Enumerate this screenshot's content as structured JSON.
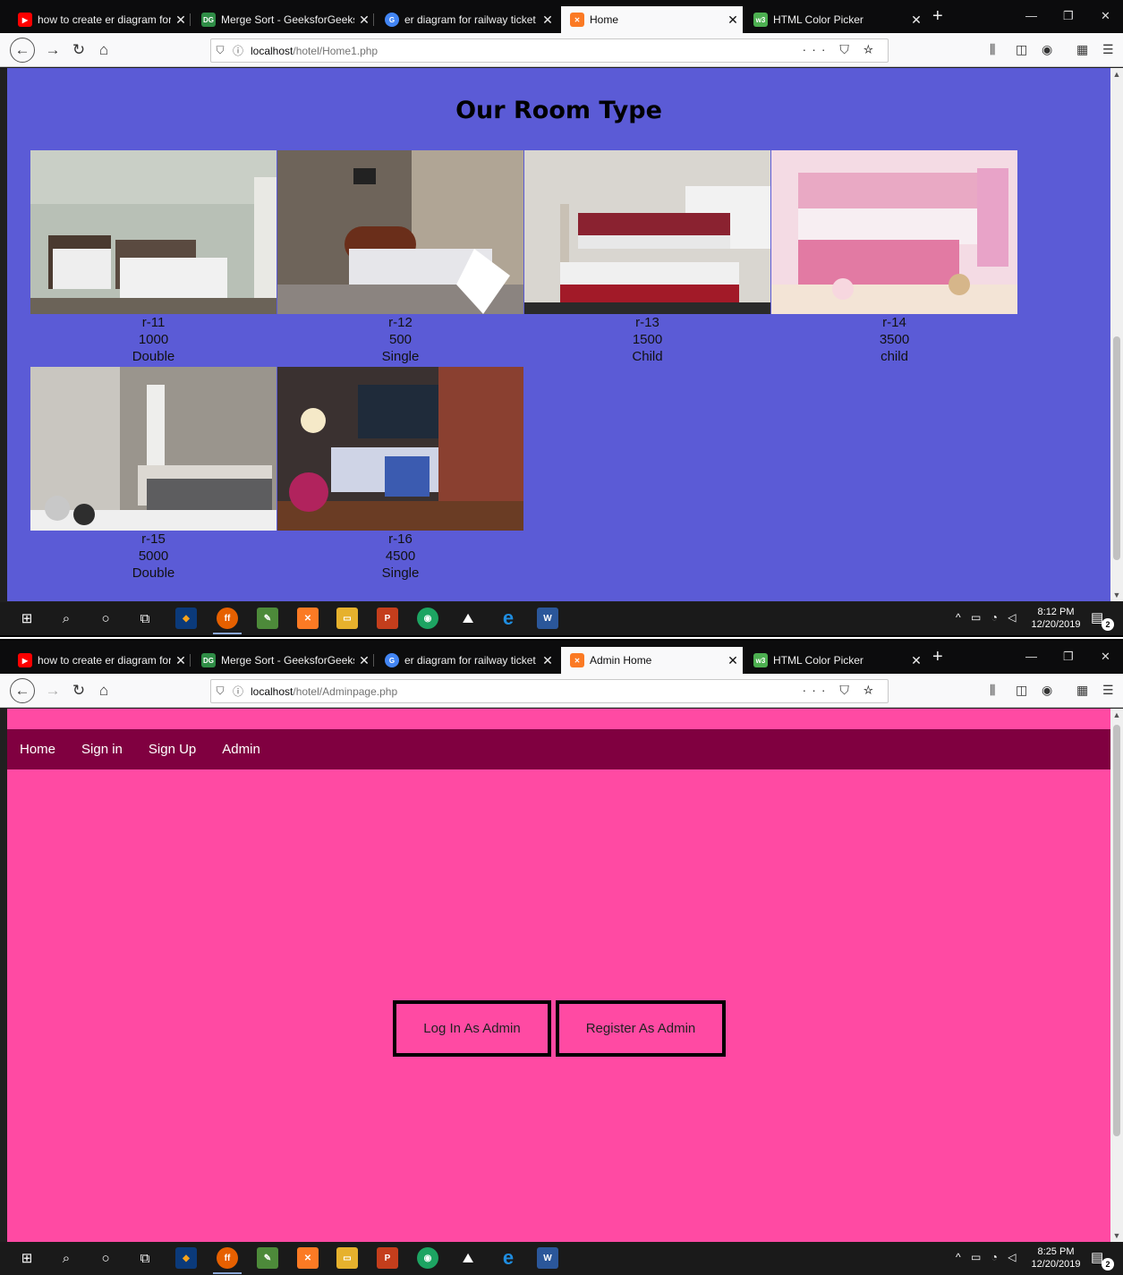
{
  "shot1": {
    "tabs": [
      {
        "title": "how to create er diagram for tr",
        "fav": "youtube-icon",
        "color": "#ff0000",
        "glyph": "▶"
      },
      {
        "title": "Merge Sort - GeeksforGeeks",
        "fav": "geeksforgeeks-icon",
        "color": "#2f8d46",
        "glyph": "DG"
      },
      {
        "title": "er diagram for railway ticket bo",
        "fav": "google-icon",
        "color": "#4285f4",
        "glyph": "G"
      },
      {
        "title": "Home",
        "fav": "xampp-icon",
        "color": "#fb7a24",
        "glyph": "✕"
      },
      {
        "title": "HTML Color Picker",
        "fav": "w3schools-icon",
        "color": "#4caf50",
        "glyph": "w3"
      }
    ],
    "url_host": "localhost",
    "url_path": "/hotel/Home1.php",
    "heading": "Our Room Type",
    "rooms": [
      {
        "id": "r-11",
        "price": "1000",
        "type": "Double"
      },
      {
        "id": "r-12",
        "price": "500",
        "type": "Single"
      },
      {
        "id": "r-13",
        "price": "1500",
        "type": "Child"
      },
      {
        "id": "r-14",
        "price": "3500",
        "type": "child"
      },
      {
        "id": "r-15",
        "price": "5000",
        "type": "Double"
      },
      {
        "id": "r-16",
        "price": "4500",
        "type": "Single"
      }
    ],
    "clock_time": "8:12 PM",
    "clock_date": "12/20/2019"
  },
  "shot2": {
    "tabs": [
      {
        "title": "how to create er diagram for tr",
        "fav": "youtube-icon",
        "color": "#ff0000",
        "glyph": "▶"
      },
      {
        "title": "Merge Sort - GeeksforGeeks",
        "fav": "geeksforgeeks-icon",
        "color": "#2f8d46",
        "glyph": "DG"
      },
      {
        "title": "er diagram for railway ticket bo",
        "fav": "google-icon",
        "color": "#4285f4",
        "glyph": "G"
      },
      {
        "title": "Admin Home",
        "fav": "xampp-icon",
        "color": "#fb7a24",
        "glyph": "✕"
      },
      {
        "title": "HTML Color Picker",
        "fav": "w3schools-icon",
        "color": "#4caf50",
        "glyph": "w3"
      }
    ],
    "url_host": "localhost",
    "url_path": "/hotel/Adminpage.php",
    "nav": [
      "Home",
      "Sign in",
      "Sign Up",
      "Admin"
    ],
    "login_btn": "Log In As Admin",
    "register_btn": "Register As Admin",
    "clock_time": "8:25 PM",
    "clock_date": "12/20/2019"
  },
  "notification_count": "2",
  "colors": {
    "page1_bg": "#5b5bd6",
    "page2_bg": "#ff4aa3",
    "page2_nav": "#800040"
  }
}
